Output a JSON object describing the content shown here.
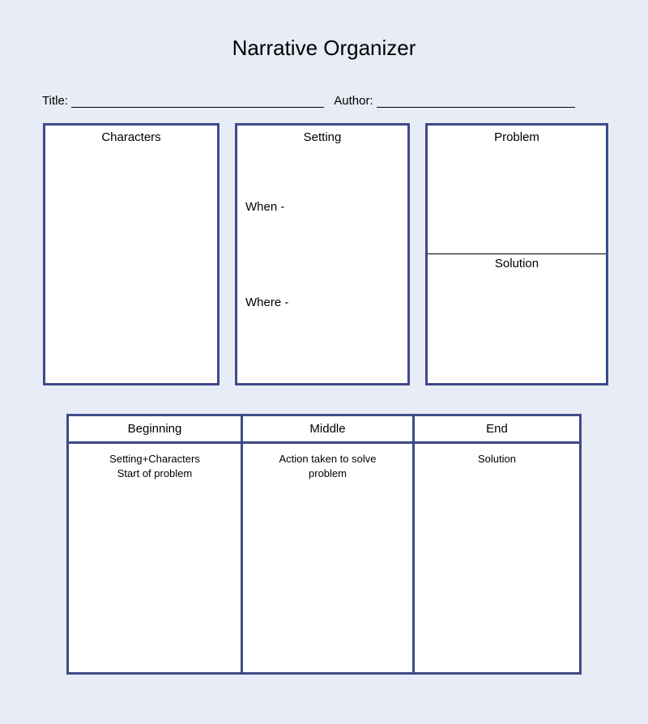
{
  "title": "Narrative Organizer",
  "fields": {
    "title_label": "Title:",
    "author_label": "Author:"
  },
  "top_boxes": {
    "characters": {
      "header": "Characters"
    },
    "setting": {
      "header": "Setting",
      "when_label": "When -",
      "where_label": "Where -"
    },
    "problem": {
      "header": "Problem",
      "solution_header": "Solution"
    }
  },
  "grid": {
    "beginning": {
      "header": "Beginning",
      "body_line1": "Setting+Characters",
      "body_line2": "Start of problem"
    },
    "middle": {
      "header": "Middle",
      "body_line1": "Action taken to solve",
      "body_line2": "problem"
    },
    "end": {
      "header": "End",
      "body_line1": "Solution",
      "body_line2": ""
    }
  }
}
